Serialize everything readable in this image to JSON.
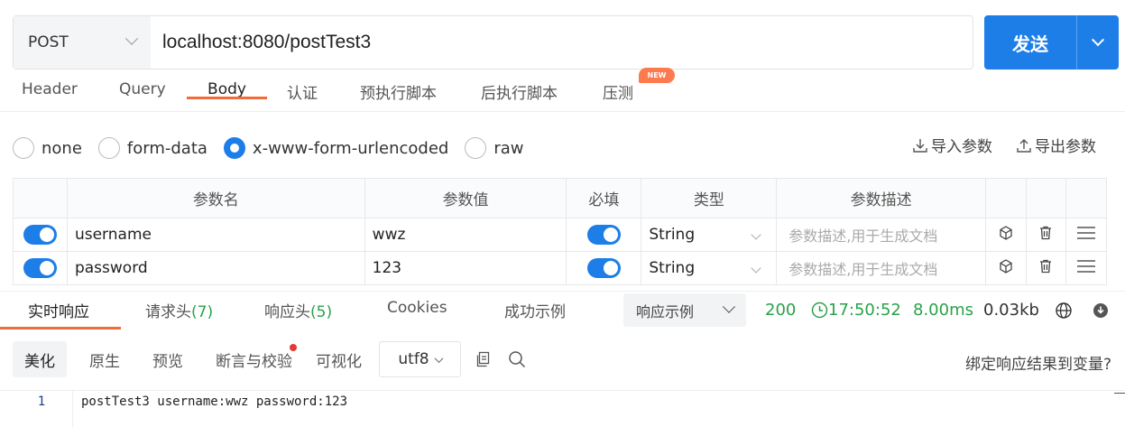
{
  "request": {
    "method": "POST",
    "url": "localhost:8080/postTest3",
    "send_label": "发送"
  },
  "tabs": [
    {
      "label": "Header"
    },
    {
      "label": "Query"
    },
    {
      "label": "Body",
      "active": true
    },
    {
      "label": "认证"
    },
    {
      "label": "预执行脚本"
    },
    {
      "label": "后执行脚本"
    },
    {
      "label": "压测"
    }
  ],
  "new_badge": "NEW",
  "body_types": [
    {
      "label": "none",
      "selected": false
    },
    {
      "label": "form-data",
      "selected": false
    },
    {
      "label": "x-www-form-urlencoded",
      "selected": true
    },
    {
      "label": "raw",
      "selected": false
    }
  ],
  "param_actions": {
    "import": "导入参数",
    "export": "导出参数"
  },
  "table": {
    "headers": [
      "参数名",
      "参数值",
      "必填",
      "类型",
      "参数描述"
    ],
    "rows": [
      {
        "enabled": true,
        "name": "username",
        "value": "wwz",
        "required": true,
        "type": "String",
        "desc_placeholder": "参数描述,用于生成文档"
      },
      {
        "enabled": true,
        "name": "password",
        "value": "123",
        "required": true,
        "type": "String",
        "desc_placeholder": "参数描述,用于生成文档"
      }
    ]
  },
  "response_tabs": {
    "realtime": "实时响应",
    "req_headers": "请求头",
    "req_headers_count": "(7)",
    "resp_headers": "响应头",
    "resp_headers_count": "(5)",
    "cookies": "Cookies",
    "success_example": "成功示例",
    "example_select": "响应示例"
  },
  "status": {
    "code": "200",
    "time": "17:50:52",
    "duration": "8.00ms",
    "size": "0.03kb"
  },
  "format_bar": {
    "beautify": "美化",
    "raw": "原生",
    "preview": "预览",
    "assert": "断言与校验",
    "visualize": "可视化",
    "encoding": "utf8",
    "bind_var": "绑定响应结果到变量?"
  },
  "code": {
    "line": "1",
    "text": "postTest3 username:wwz password:123"
  },
  "colors": {
    "accent": "#1d7ee8",
    "tab_underline": "#f26b3a",
    "success": "#2aa14a"
  }
}
